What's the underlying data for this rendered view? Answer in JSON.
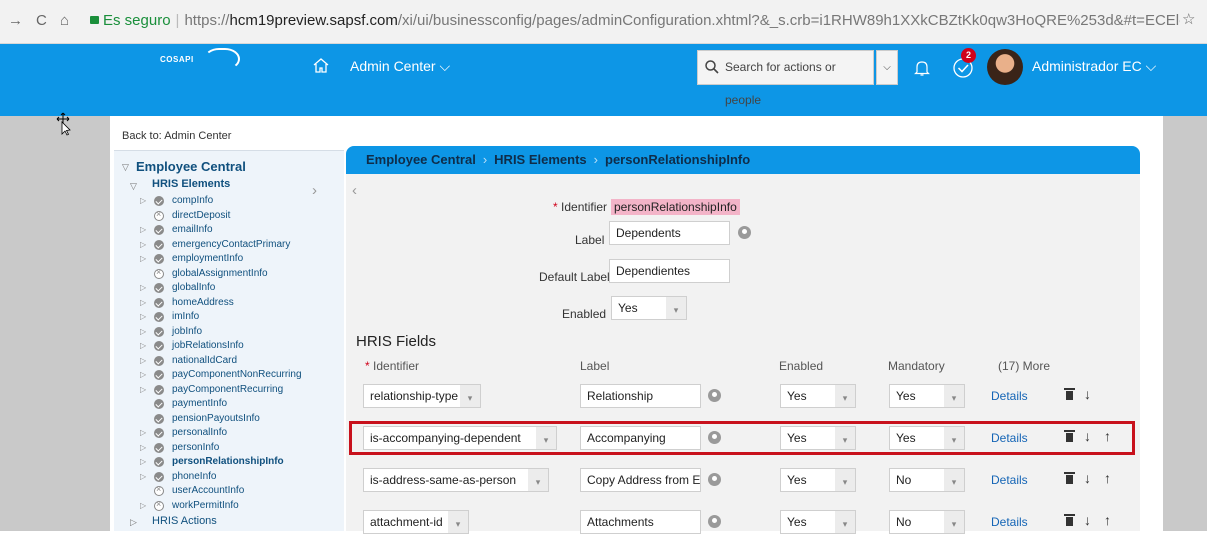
{
  "browser": {
    "back": "→",
    "reload": "C",
    "home": "⌂",
    "secure_label": "Es seguro",
    "url_scheme": "https://",
    "url_host": "hcm19preview.sapsf.com",
    "url_path": "/xi/ui/businessconfig/pages/adminConfiguration.xhtml?&_s.crb=i1RHW89h1XXkCBZtKk0qw3HoQRE%253d&#t=ECElementConfig&...",
    "star": "☆"
  },
  "header": {
    "logo": "COSAPI",
    "module": "Admin Center ⌵",
    "search_placeholder": "Search for actions or people",
    "search_dropdown": "⌵",
    "notification_count": "2",
    "user": "Administrador EC ⌵",
    "brand_color": "#0d96e6"
  },
  "back_link": "Back to: Admin Center",
  "tree": {
    "root": "Employee Central",
    "group": "HRIS Elements",
    "items": [
      {
        "label": "compInfo",
        "status": "ok",
        "expandable": true
      },
      {
        "label": "directDeposit",
        "status": "no",
        "expandable": false
      },
      {
        "label": "emailInfo",
        "status": "ok",
        "expandable": true
      },
      {
        "label": "emergencyContactPrimary",
        "status": "ok",
        "expandable": true
      },
      {
        "label": "employmentInfo",
        "status": "ok",
        "expandable": true
      },
      {
        "label": "globalAssignmentInfo",
        "status": "no",
        "expandable": false
      },
      {
        "label": "globalInfo",
        "status": "ok",
        "expandable": true
      },
      {
        "label": "homeAddress",
        "status": "ok",
        "expandable": true
      },
      {
        "label": "imInfo",
        "status": "ok",
        "expandable": true
      },
      {
        "label": "jobInfo",
        "status": "ok",
        "expandable": true
      },
      {
        "label": "jobRelationsInfo",
        "status": "ok",
        "expandable": true
      },
      {
        "label": "nationalIdCard",
        "status": "ok",
        "expandable": true
      },
      {
        "label": "payComponentNonRecurring",
        "status": "ok",
        "expandable": true
      },
      {
        "label": "payComponentRecurring",
        "status": "ok",
        "expandable": true
      },
      {
        "label": "paymentInfo",
        "status": "ok",
        "expandable": false
      },
      {
        "label": "pensionPayoutsInfo",
        "status": "ok",
        "expandable": false
      },
      {
        "label": "personalInfo",
        "status": "ok",
        "expandable": true
      },
      {
        "label": "personInfo",
        "status": "ok",
        "expandable": true
      },
      {
        "label": "personRelationshipInfo",
        "status": "ok",
        "expandable": true,
        "selected": true
      },
      {
        "label": "phoneInfo",
        "status": "ok",
        "expandable": true
      },
      {
        "label": "userAccountInfo",
        "status": "no",
        "expandable": false
      },
      {
        "label": "workPermitInfo",
        "status": "no",
        "expandable": true
      }
    ],
    "next_group": "HRIS Actions"
  },
  "panel": {
    "breadcrumb": [
      "Employee Central",
      "HRIS Elements",
      "personRelationshipInfo"
    ],
    "identifier_label": "Identifier",
    "identifier_value": "personRelationshipInfo",
    "label_label": "Label",
    "label_value": "Dependents",
    "default_label_label": "Default Label",
    "default_label_value": "Dependientes",
    "enabled_label": "Enabled",
    "enabled_value": "Yes",
    "fields_title": "HRIS Fields",
    "columns": {
      "identifier": "Identifier",
      "label": "Label",
      "enabled": "Enabled",
      "mandatory": "Mandatory",
      "more": "(17) More"
    },
    "details_label": "Details",
    "rows": [
      {
        "identifier": "relationship-type",
        "label": "Relationship",
        "enabled": "Yes",
        "mandatory": "Yes"
      },
      {
        "identifier": "is-accompanying-dependent",
        "label": "Accompanying",
        "enabled": "Yes",
        "mandatory": "Yes"
      },
      {
        "identifier": "is-address-same-as-person",
        "label": "Copy Address from Em",
        "enabled": "Yes",
        "mandatory": "No"
      },
      {
        "identifier": "attachment-id",
        "label": "Attachments",
        "enabled": "Yes",
        "mandatory": "No"
      }
    ]
  }
}
